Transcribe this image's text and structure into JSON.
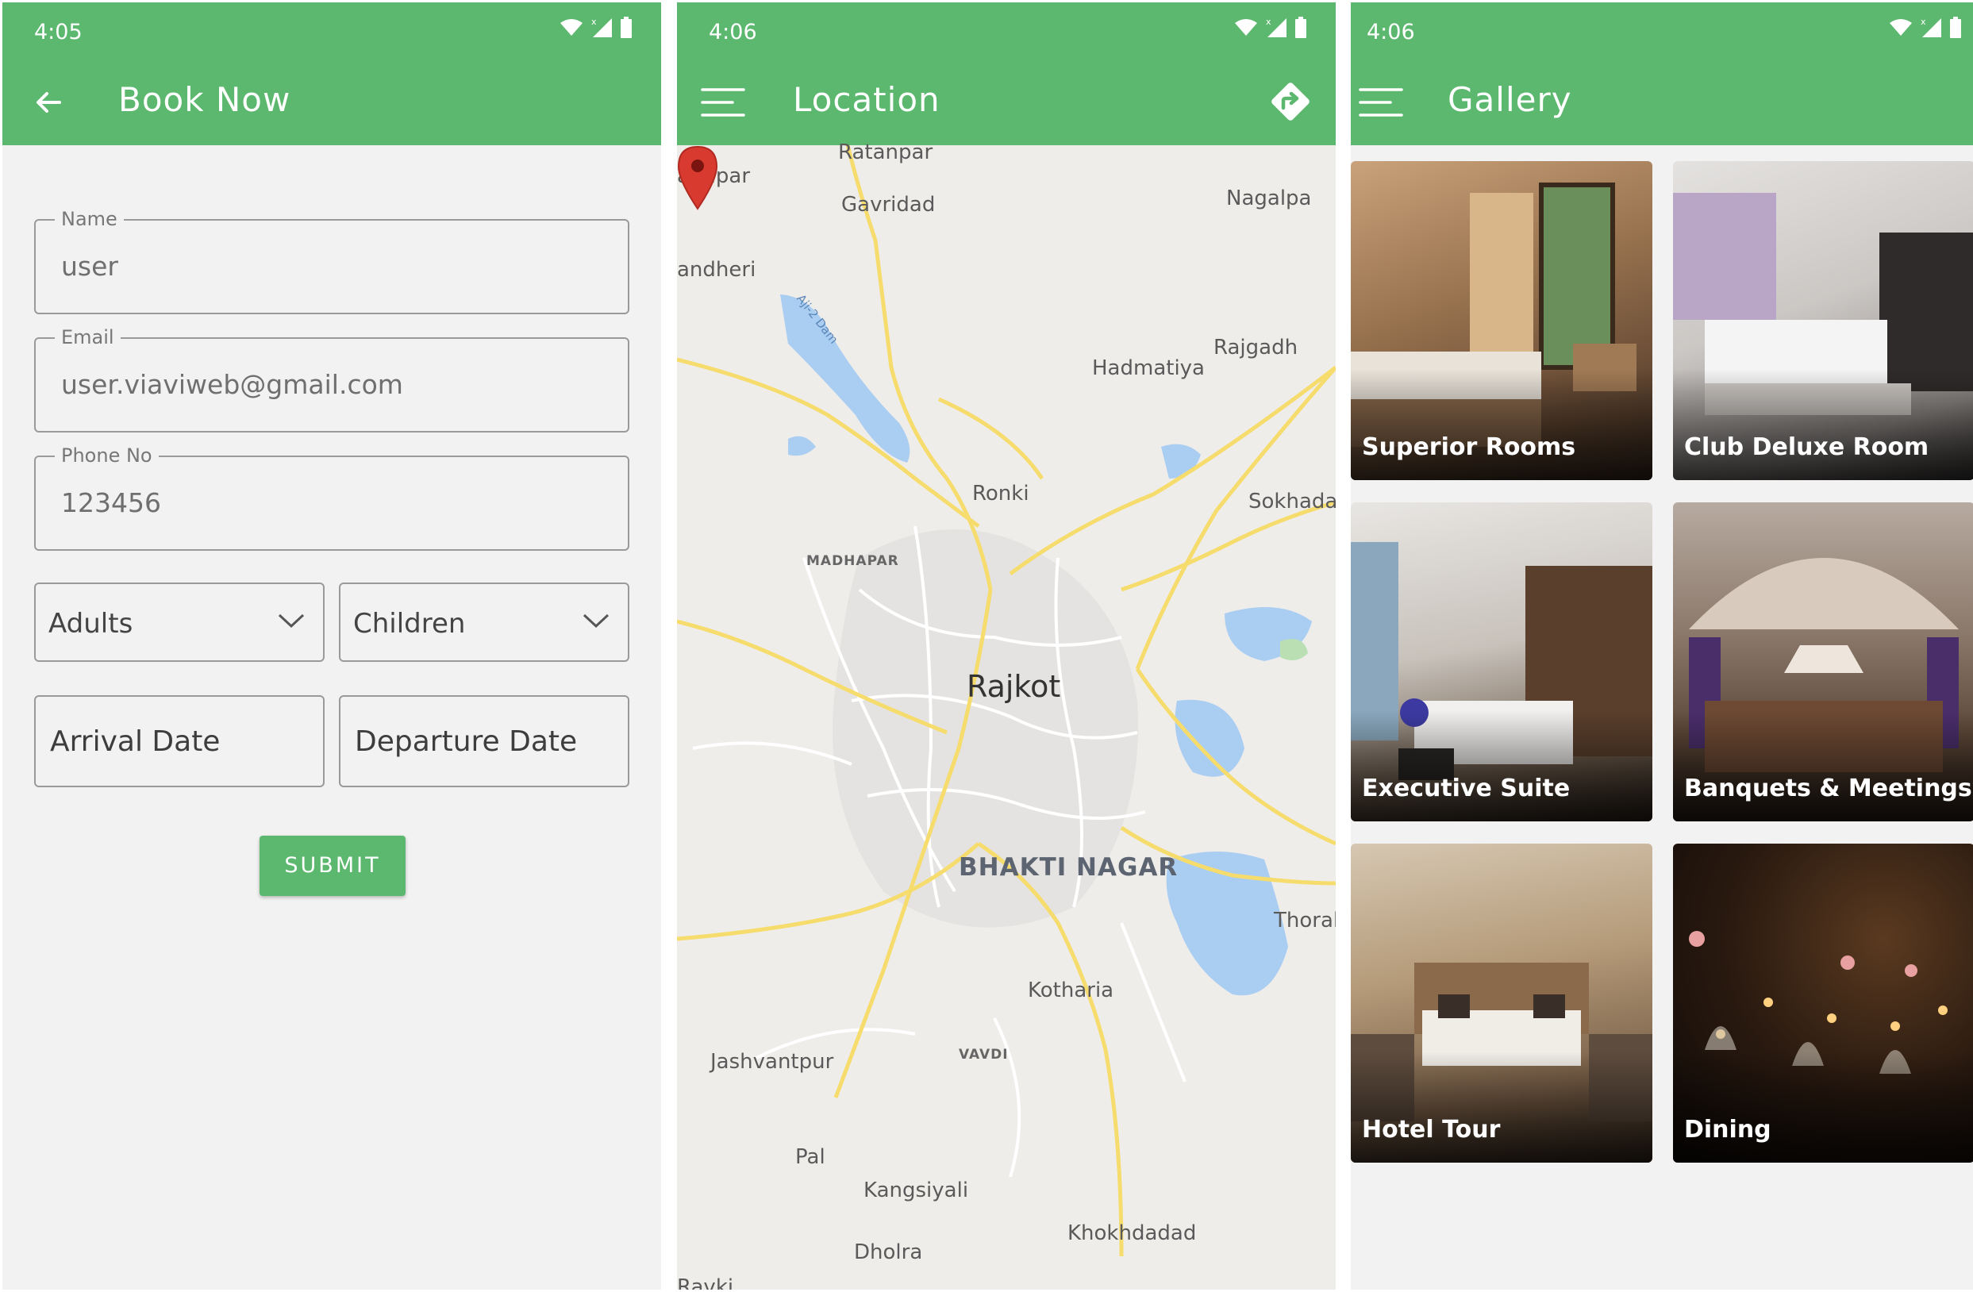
{
  "colors": {
    "primary": "#5db86f",
    "background": "#f2f2f2",
    "map_road": "#f6dc6c",
    "map_water": "#aacdf2",
    "pin": "#d93a2f"
  },
  "booking": {
    "status_time": "4:05",
    "title": "Book Now",
    "name_label": "Name",
    "name_value": "user",
    "email_label": "Email",
    "email_value": "user.viaviweb@gmail.com",
    "phone_label": "Phone No",
    "phone_value": "123456",
    "adults_label": "Adults",
    "children_label": "Children",
    "arrival_label": "Arrival Date",
    "departure_label": "Departure Date",
    "submit_label": "SUBMIT"
  },
  "location": {
    "status_time": "4:06",
    "title": "Location",
    "places": {
      "ratanpar": "Ratanpar",
      "andpar": "andpar",
      "gavridad": "Gavridad",
      "nagalpa": "Nagalpa",
      "andheri": "andheri",
      "dam": "Aji-2 Dam",
      "hadmatiya": "Hadmatiya",
      "rajgadh": "Rajgadh",
      "ronki": "Ronki",
      "sokhada": "Sokhada",
      "madhapar": "MADHAPAR",
      "rajkot": "Rajkot",
      "bhakti_nagar": "BHAKTI NAGAR",
      "thorala": "Thorala",
      "kotharia": "Kotharia",
      "jashvantpur": "Jashvantpur",
      "vavdi": "VAVDI",
      "pal": "Pal",
      "kangsiyali": "Kangsiyali",
      "khokhdadad": "Khokhdadad",
      "dholra": "Dholra",
      "ravki": "Ravki"
    }
  },
  "gallery": {
    "status_time": "4:06",
    "title": "Gallery",
    "items": [
      {
        "label": "Superior Rooms"
      },
      {
        "label": "Club Deluxe Room"
      },
      {
        "label": "Executive Suite"
      },
      {
        "label": "Banquets & Meetings"
      },
      {
        "label": "Hotel Tour"
      },
      {
        "label": "Dining"
      }
    ]
  }
}
